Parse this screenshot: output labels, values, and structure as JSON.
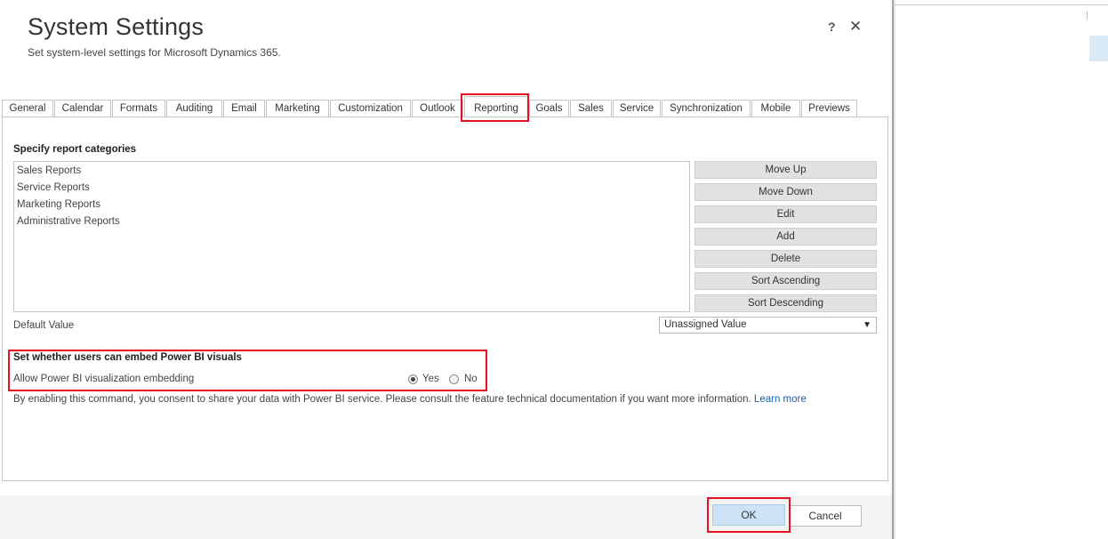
{
  "dialog": {
    "title": "System Settings",
    "subtitle": "Set system-level settings for Microsoft Dynamics 365.",
    "help_glyph": "?",
    "close_glyph": "✕"
  },
  "tabs": [
    {
      "label": "General"
    },
    {
      "label": "Calendar"
    },
    {
      "label": "Formats"
    },
    {
      "label": "Auditing"
    },
    {
      "label": "Email"
    },
    {
      "label": "Marketing"
    },
    {
      "label": "Customization"
    },
    {
      "label": "Outlook"
    },
    {
      "label": "Reporting",
      "active": true
    },
    {
      "label": "Goals"
    },
    {
      "label": "Sales"
    },
    {
      "label": "Service"
    },
    {
      "label": "Synchronization"
    },
    {
      "label": "Mobile"
    },
    {
      "label": "Previews"
    }
  ],
  "report_categories": {
    "heading": "Specify report categories",
    "items": [
      "Sales Reports",
      "Service Reports",
      "Marketing Reports",
      "Administrative Reports"
    ],
    "buttons": {
      "move_up": "Move Up",
      "move_down": "Move Down",
      "edit": "Edit",
      "add": "Add",
      "delete": "Delete",
      "sort_ascending": "Sort Ascending",
      "sort_descending": "Sort Descending"
    },
    "default_value_label": "Default Value",
    "default_value": "Unassigned Value",
    "dropdown_glyph": "▼"
  },
  "power_bi": {
    "heading": "Set whether users can embed Power BI visuals",
    "option_label": "Allow Power BI visualization embedding",
    "yes_label": "Yes",
    "no_label": "No",
    "selected": "Yes",
    "consent_text": "By enabling this command, you consent to share your data with Power BI service. Please consult the feature technical documentation if you want more information.",
    "learn_more": "Learn more"
  },
  "footer": {
    "ok_label": "OK",
    "cancel_label": "Cancel"
  },
  "colors": {
    "highlight": "#e81123",
    "ok_button": "#cde3f5",
    "link": "#1160b7"
  }
}
